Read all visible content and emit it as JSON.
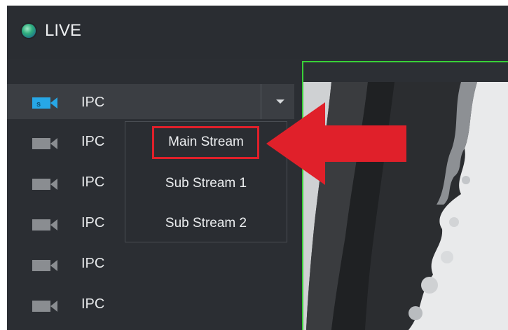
{
  "header": {
    "title": "LIVE",
    "status_color": "#2fae7d"
  },
  "channels": [
    {
      "label": "IPC",
      "icon": "camera-icon",
      "active": true
    },
    {
      "label": "IPC",
      "icon": "camera-icon"
    },
    {
      "label": "IPC",
      "icon": "camera-icon"
    },
    {
      "label": "IPC",
      "icon": "camera-icon"
    },
    {
      "label": "IPC",
      "icon": "camera-icon"
    },
    {
      "label": "IPC",
      "icon": "camera-icon"
    }
  ],
  "stream_menu": {
    "items": [
      "Main Stream",
      "Sub Stream 1",
      "Sub Stream 2"
    ],
    "highlighted": "Main Stream"
  },
  "colors": {
    "accent_active_icon": "#27a7e6",
    "selection_border": "#39d038",
    "annotation": "#e0202a"
  }
}
